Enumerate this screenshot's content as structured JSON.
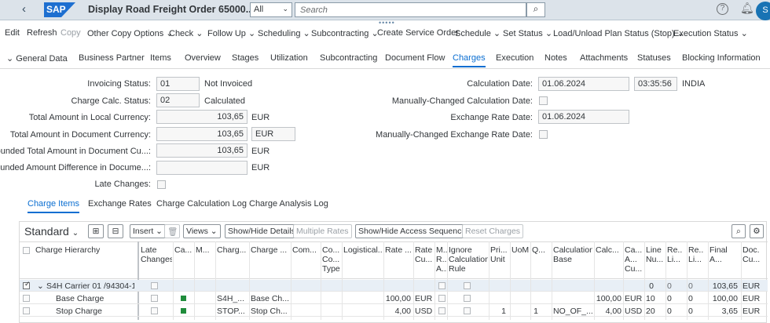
{
  "shell": {
    "back": "‹",
    "logo": "SAP",
    "title": "Display Road Freight Order 65000...",
    "scope": "All",
    "search_placeholder": "Search",
    "avatar": "S"
  },
  "toolbar": [
    "Edit",
    "Refresh",
    "Copy",
    "Other Copy Options",
    "Check",
    "Follow Up",
    "Scheduling",
    "Subcontracting",
    "Create Service Order",
    "Schedule",
    "Set Status",
    "Load/Unload Plan Status (Stop)",
    "Execution Status"
  ],
  "tabs": [
    "General Data",
    "Business Partner",
    "Items",
    "Overview",
    "Stages",
    "Utilization",
    "Subcontracting",
    "Document Flow",
    "Charges",
    "Execution",
    "Notes",
    "Attachments",
    "Statuses",
    "Blocking Information"
  ],
  "form": {
    "invoicing_status_label": "Invoicing Status:",
    "invoicing_status": "01",
    "invoicing_status_text": "Not Invoiced",
    "charge_calc_label": "Charge Calc. Status:",
    "charge_calc": "02",
    "charge_calc_text": "Calculated",
    "total_local_label": "Total Amount in Local Currency:",
    "total_local": "103,65",
    "total_local_cur": "EUR",
    "total_doc_label": "Total Amount in Document Currency:",
    "total_doc": "103,65",
    "total_doc_cur": "EUR",
    "rounded_total_label": "Rounded Total Amount in Document Cu...:",
    "rounded_total": "103,65",
    "rounded_total_cur": "EUR",
    "rounded_diff_label": "Rounded Amount Difference in Docume...:",
    "rounded_diff": "",
    "rounded_diff_cur": "EUR",
    "late_changes_label": "Late Changes:",
    "calc_date_label": "Calculation Date:",
    "calc_date": "01.06.2024",
    "calc_time": "03:35:56",
    "calc_tz": "INDIA",
    "manual_calc_label": "Manually-Changed Calculation Date:",
    "exch_date_label": "Exchange Rate Date:",
    "exch_date": "01.06.2024",
    "manual_exch_label": "Manually-Changed Exchange Rate Date:"
  },
  "subtabs": [
    "Charge Items",
    "Exchange Rates",
    "Charge Calculation Log",
    "Charge Analysis Log"
  ],
  "table": {
    "title": "Standard",
    "buttons": {
      "insert": "Insert",
      "views": "Views",
      "show_hide_details": "Show/Hide Details",
      "multiple_rates": "Multiple Rates",
      "show_hide_access": "Show/Hide Access Sequence",
      "reset_charges": "Reset Charges"
    },
    "columns": [
      "Charge Hierarchy",
      "Late Changes",
      "Ca...",
      "M...",
      "Charg...",
      "Charge ...",
      "Com...",
      "Co... Co... Type",
      "Logistical...",
      "Rate ...",
      "Rate Cu...",
      "M... R... A...",
      "Ignore Calculation Rule",
      "Pri... Unit",
      "UoM",
      "Q...",
      "Calculation Base",
      "Calc...",
      "Ca... A... Cu...",
      "Line Nu...",
      "Re... Li...",
      "Re... Li...",
      "Final A...",
      "Doc. Cu..."
    ],
    "rows": [
      {
        "hier": "S4H Carrier 01 /94304-1...",
        "indent": 1,
        "selected": true,
        "calc_cb": "",
        "charg": "",
        "charge": "",
        "rate": "",
        "rate_cur": "",
        "pri": "",
        "q": "",
        "calc_base": "",
        "calc": "",
        "ca_cur": "",
        "line": "0",
        "re1": "0",
        "re2": "0",
        "final": "103,65",
        "doc": "EUR"
      },
      {
        "hier": "Base Charge",
        "indent": 2,
        "selected": false,
        "charg": "S4H_...",
        "charge": "Base Ch...",
        "rate": "100,00",
        "rate_cur": "EUR",
        "pri": "",
        "q": "",
        "calc_base": "",
        "calc": "100,00",
        "ca_cur": "EUR",
        "line": "10",
        "re1": "0",
        "re2": "0",
        "final": "100,00",
        "doc": "EUR"
      },
      {
        "hier": "Stop Charge",
        "indent": 2,
        "selected": false,
        "charg": "STOP...",
        "charge": "Stop Ch...",
        "rate": "4,00",
        "rate_cur": "USD",
        "pri": "1",
        "q": "1",
        "calc_base": "NO_OF_...",
        "calc": "4,00",
        "ca_cur": "USD",
        "line": "20",
        "re1": "0",
        "re2": "0",
        "final": "3,65",
        "doc": "EUR"
      }
    ]
  }
}
